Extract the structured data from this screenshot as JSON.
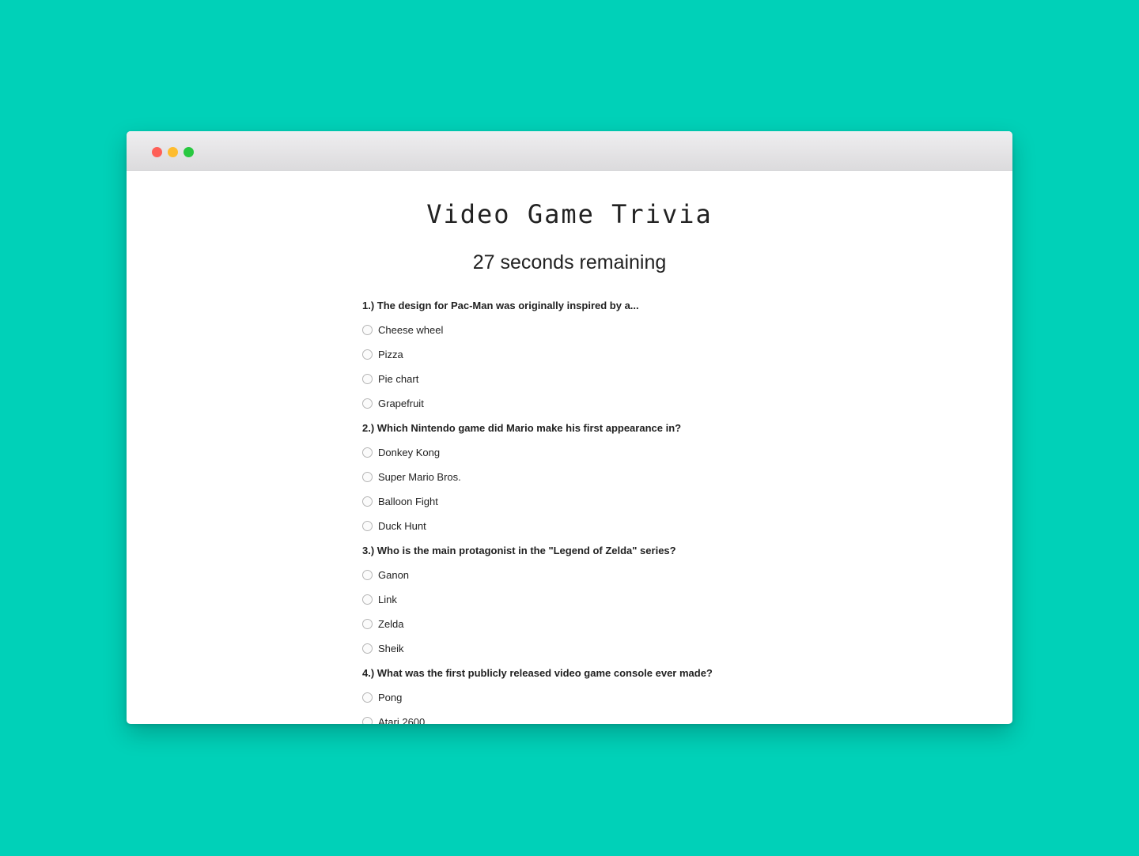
{
  "window": {
    "controls": [
      "close",
      "minimize",
      "maximize"
    ]
  },
  "page": {
    "title": "Video Game Trivia",
    "timer": "27 seconds remaining"
  },
  "questions": [
    {
      "text": "1.) The design for Pac-Man was originally inspired by a...",
      "options": [
        "Cheese wheel",
        "Pizza",
        "Pie chart",
        "Grapefruit"
      ]
    },
    {
      "text": "2.) Which Nintendo game did Mario make his first appearance in?",
      "options": [
        "Donkey Kong",
        "Super Mario Bros.",
        "Balloon Fight",
        "Duck Hunt"
      ]
    },
    {
      "text": "3.) Who is the main protagonist in the \"Legend of Zelda\" series?",
      "options": [
        "Ganon",
        "Link",
        "Zelda",
        "Sheik"
      ]
    },
    {
      "text": "4.) What was the first publicly released video game console ever made?",
      "options": [
        "Pong",
        "Atari 2600"
      ]
    }
  ],
  "colors": {
    "background": "#00d1b8",
    "close": "#fe5f57",
    "minimize": "#febc2e",
    "maximize": "#28c840"
  }
}
